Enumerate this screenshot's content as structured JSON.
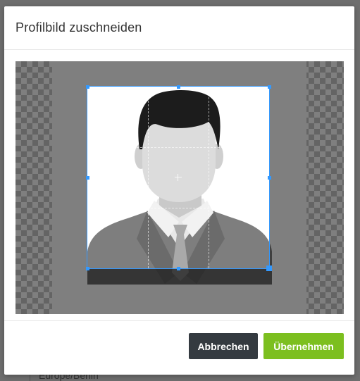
{
  "background": {
    "visible_field_text": "Europe/Berlin"
  },
  "modal": {
    "title": "Profilbild zuschneiden",
    "cancel_label": "Abbrechen",
    "accept_label": "Übernehmen"
  },
  "colors": {
    "accent": "#3399ff",
    "accept_button": "#7cbf1f",
    "cancel_button": "#343a40",
    "hair": "#1c1c1c",
    "face": "#dcdcdc",
    "suit": "#7e7e7e"
  },
  "icons": {
    "avatar": "person-placeholder-icon"
  }
}
